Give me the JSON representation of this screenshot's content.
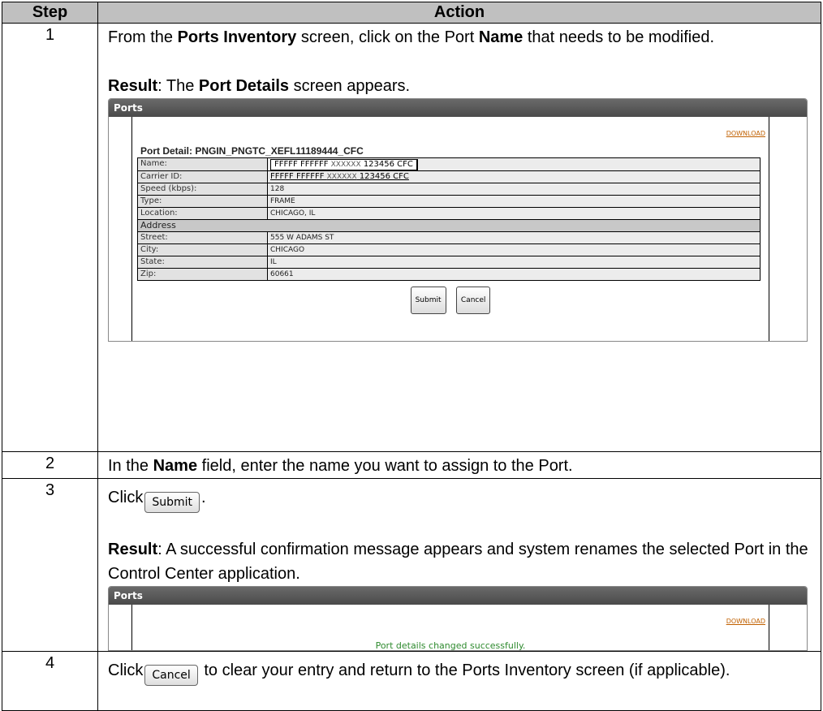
{
  "table": {
    "header_step": "Step",
    "header_action": "Action"
  },
  "step1": {
    "num": "1",
    "text_pre": "From the ",
    "text_b1": "Ports Inventory",
    "text_mid": " screen, click on the Port ",
    "text_b2": "Name",
    "text_post": " that needs to be modified.",
    "result_label": "Result",
    "result_mid": ":  The ",
    "result_b": "Port Details",
    "result_post": " screen appears."
  },
  "panel1": {
    "title": "Ports",
    "download": "DOWNLOAD",
    "detail_title": "Port Detail: PNGIN_PNGTC_XEFL11189444_CFC",
    "rows": [
      {
        "label": "Name:",
        "value": ""
      },
      {
        "label": "Carrier ID:",
        "value": ""
      },
      {
        "label": "Speed (kbps):",
        "value": "128"
      },
      {
        "label": "Type:",
        "value": "FRAME"
      },
      {
        "label": "Location:",
        "value": "CHICAGO, IL"
      }
    ],
    "name_a": "FFFFF FFFFFF ",
    "name_b": "XXXXXX",
    "name_c": " 123456  CFC",
    "carrier_a": "FFFFF FFFFFF ",
    "carrier_b": "XXXXXX",
    "carrier_c": " 123456  CFC",
    "address_header": "Address",
    "address_rows": [
      {
        "label": "Street:",
        "value": "555 W ADAMS ST"
      },
      {
        "label": "City:",
        "value": "CHICAGO"
      },
      {
        "label": "State:",
        "value": "IL"
      },
      {
        "label": "Zip:",
        "value": "60661"
      }
    ],
    "submit": "Submit",
    "cancel": "Cancel"
  },
  "step2": {
    "num": "2",
    "text_pre": "In the ",
    "text_b": "Name",
    "text_post": " field, enter the name you want to assign to the Port."
  },
  "step3": {
    "num": "3",
    "click": "Click",
    "button": "Submit",
    "after": ".",
    "result_label": "Result",
    "result_text": ": A successful confirmation message appears and system renames the selected Port in the Control Center application."
  },
  "panel2": {
    "title": "Ports",
    "download": "DOWNLOAD",
    "message": "Port details changed successfully."
  },
  "step4": {
    "num": "4",
    "click": "Click",
    "button": "Cancel",
    "text_post": " to clear your entry and return to the Ports Inventory screen (if applicable)."
  }
}
